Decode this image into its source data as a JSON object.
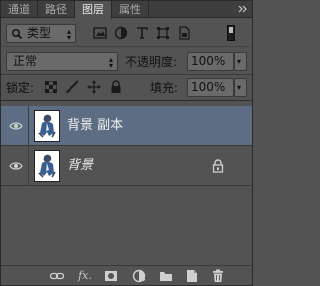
{
  "tabs": [
    {
      "label": "通道",
      "active": false
    },
    {
      "label": "路径",
      "active": false
    },
    {
      "label": "图层",
      "active": true
    },
    {
      "label": "属性",
      "active": false
    }
  ],
  "filter": {
    "search_icon": "search-icon",
    "type_label": "类型"
  },
  "blend": {
    "mode": "正常",
    "opacity_label": "不透明度:",
    "opacity_value": "100%"
  },
  "lock": {
    "label": "锁定:",
    "fill_label": "填充:",
    "fill_value": "100%"
  },
  "layers": [
    {
      "name": "背景 副本",
      "selected": true,
      "visible": true,
      "locked": false
    },
    {
      "name": "背景",
      "selected": false,
      "visible": true,
      "locked": true
    }
  ],
  "footer": {
    "fx_label": "fx."
  },
  "colors": {
    "panel": "#535353",
    "tabbar": "#3e3e3e",
    "selection": "#5d6d83",
    "field": "#6a6a6a"
  }
}
